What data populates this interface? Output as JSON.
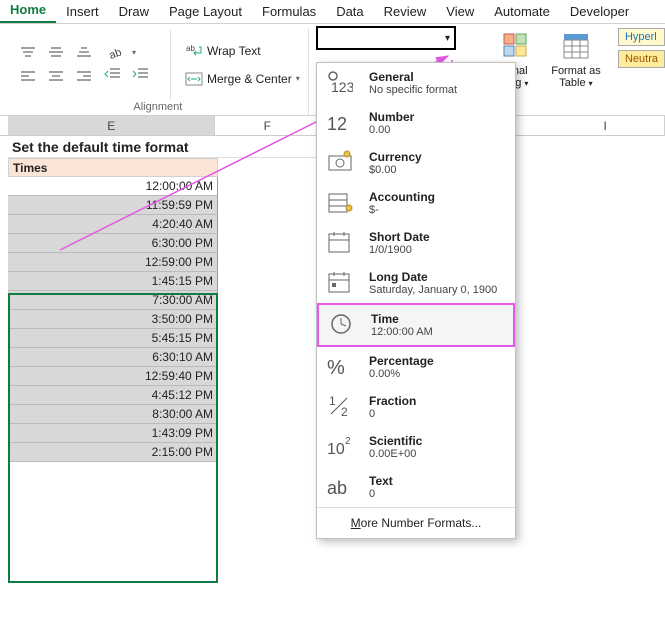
{
  "tabs": [
    "Home",
    "Insert",
    "Draw",
    "Page Layout",
    "Formulas",
    "Data",
    "Review",
    "View",
    "Automate",
    "Developer"
  ],
  "active_tab": 0,
  "alignment": {
    "wrap_label": "Wrap Text",
    "merge_label": "Merge & Center",
    "group_label": "Alignment"
  },
  "right_items": {
    "conditional": "ional\nting",
    "formatAs": "Format as\nTable",
    "hyperl": "Hyperl",
    "neutral": "Neutra"
  },
  "number_format_value": "",
  "dropdown": [
    {
      "title": "General",
      "sub": "No specific format",
      "icon": "general"
    },
    {
      "title": "Number",
      "sub": "0.00",
      "icon": "number"
    },
    {
      "title": "Currency",
      "sub": "$0.00",
      "icon": "currency"
    },
    {
      "title": "Accounting",
      "sub": "$-",
      "icon": "accounting"
    },
    {
      "title": "Short Date",
      "sub": "1/0/1900",
      "icon": "shortdate"
    },
    {
      "title": "Long Date",
      "sub": "Saturday, January 0, 1900",
      "icon": "longdate"
    },
    {
      "title": "Time",
      "sub": "12:00:00 AM",
      "icon": "time",
      "selected": true
    },
    {
      "title": "Percentage",
      "sub": "0.00%",
      "icon": "percent"
    },
    {
      "title": "Fraction",
      "sub": "0",
      "icon": "fraction"
    },
    {
      "title": "Scientific",
      "sub": "0.00E+00",
      "icon": "scientific"
    },
    {
      "title": "Text",
      "sub": "0",
      "icon": "text"
    }
  ],
  "dropdown_footer_pre": "M",
  "dropdown_footer_rest": "ore Number Formats...",
  "columns": {
    "E": "E",
    "F": "F",
    "I": "I"
  },
  "sheet": {
    "title": "Set the default time format",
    "header": "Times",
    "data": [
      "12:00:00 AM",
      "11:59:59 PM",
      "4:20:40 AM",
      "6:30:00 PM",
      "12:59:00 PM",
      "1:45:15 PM",
      "7:30:00 AM",
      "3:50:00 PM",
      "5:45:15 PM",
      "6:30:10 AM",
      "12:59:40 PM",
      "4:45:12 PM",
      "8:30:00 AM",
      "1:43:09 PM",
      "2:15:00 PM"
    ]
  },
  "colors": {
    "accent": "#107c41",
    "highlight": "#e658e6",
    "header_fill": "#fce4d6"
  }
}
